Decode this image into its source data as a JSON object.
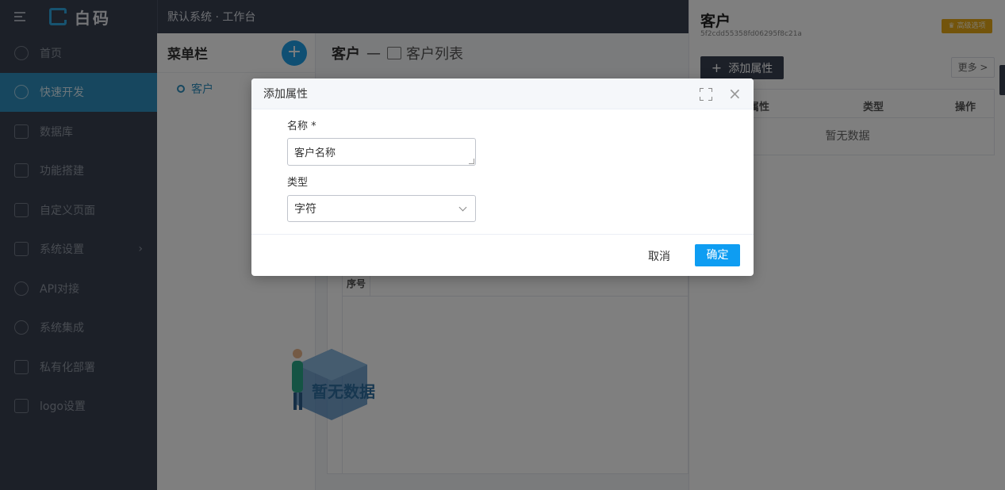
{
  "brand": {
    "name": "白码"
  },
  "header": {
    "title": "默认系统 · 工作台"
  },
  "sidebar": {
    "items": [
      {
        "label": "首页",
        "icon": "home-icon"
      },
      {
        "label": "快速开发",
        "icon": "cube-icon",
        "active": true
      },
      {
        "label": "数据库",
        "icon": "database-icon"
      },
      {
        "label": "功能搭建",
        "icon": "build-icon"
      },
      {
        "label": "自定义页面",
        "icon": "page-icon"
      },
      {
        "label": "系统设置",
        "icon": "monitor-icon"
      },
      {
        "label": "API对接",
        "icon": "api-icon"
      },
      {
        "label": "系统集成",
        "icon": "layers-icon"
      },
      {
        "label": "私有化部署",
        "icon": "deploy-icon"
      },
      {
        "label": "logo设置",
        "icon": "logo-icon"
      }
    ]
  },
  "menu_panel": {
    "title": "菜单栏",
    "add_label": "+",
    "entries": [
      {
        "label": "客户"
      }
    ]
  },
  "main": {
    "title": "客户",
    "dash": "—",
    "subtitle": "客户列表",
    "table_header_index": "序号",
    "empty_text": "暂无数据"
  },
  "drawer": {
    "title": "客户",
    "id": "5f2cdd55358fd06295f8c21a",
    "advanced_label": "♛ 高级选项",
    "add_attr_label": "添加属性",
    "add_attr_plus": "+",
    "more_label": "更多 >",
    "columns": [
      "属性",
      "类型",
      "操作"
    ],
    "empty_text": "暂无数据"
  },
  "dialog": {
    "title": "添加属性",
    "name_label": "名称 *",
    "name_value": "客户名称",
    "type_label": "类型",
    "type_value": "字符",
    "cancel_label": "取消",
    "ok_label": "确定"
  },
  "colors": {
    "sidebar_bg": "#394050",
    "active": "#2e8fbe",
    "primary": "#0e9df2",
    "warning": "#e6a817"
  }
}
